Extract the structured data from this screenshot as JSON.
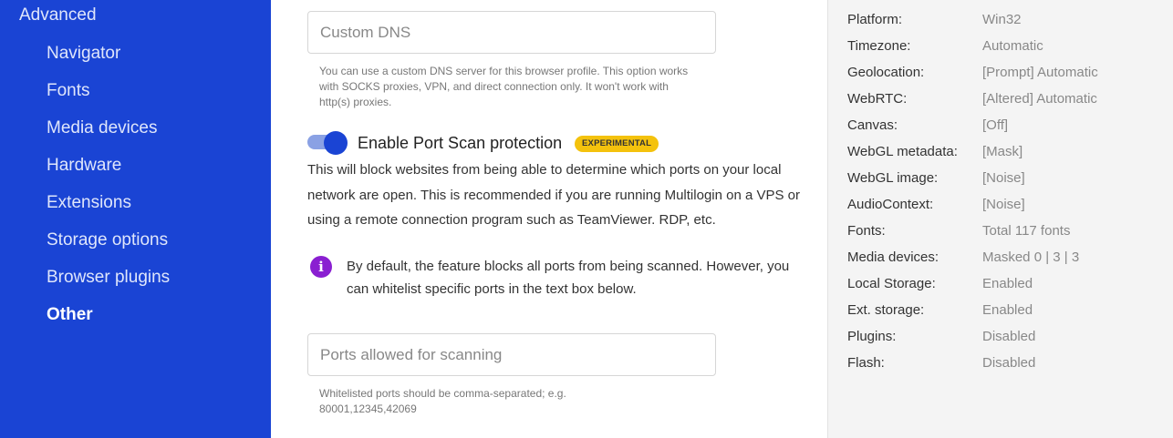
{
  "sidebar": {
    "section_title": "Advanced",
    "items": [
      {
        "label": "Navigator"
      },
      {
        "label": "Fonts"
      },
      {
        "label": "Media devices"
      },
      {
        "label": "Hardware"
      },
      {
        "label": "Extensions"
      },
      {
        "label": "Storage options"
      },
      {
        "label": "Browser plugins"
      },
      {
        "label": "Other",
        "active": true
      }
    ]
  },
  "main": {
    "custom_dns": {
      "placeholder": "Custom DNS",
      "value": "",
      "hint": "You can use a custom DNS server for this browser profile. This option works with SOCKS proxies, VPN, and direct connection only. It won't work with http(s) proxies."
    },
    "port_scan": {
      "toggle_on": true,
      "label": "Enable Port Scan protection",
      "badge": "EXPERIMENTAL",
      "description": "This will block websites from being able to determine which ports on your local network are open. This is recommended if you are running Multilogin on a VPS or using a remote connection program such as TeamViewer. RDP, etc.",
      "info_icon": "info-icon",
      "info": "By default, the feature blocks all ports from being scanned. However, you can whitelist specific ports in the text box below."
    },
    "ports_allowed": {
      "placeholder": "Ports allowed for scanning",
      "value": "",
      "hint": "Whitelisted ports should be comma-separated; e.g. 80001,12345,42069"
    }
  },
  "summary": {
    "rows": [
      {
        "key": "Platform:",
        "value": "Win32"
      },
      {
        "key": "Timezone:",
        "value": "Automatic"
      },
      {
        "key": "Geolocation:",
        "value": "[Prompt] Automatic"
      },
      {
        "key": "WebRTC:",
        "value": "[Altered] Automatic"
      },
      {
        "key": "Canvas:",
        "value": "[Off]"
      },
      {
        "key": "WebGL metadata:",
        "value": "[Mask]"
      },
      {
        "key": "WebGL image:",
        "value": "[Noise]"
      },
      {
        "key": "AudioContext:",
        "value": "[Noise]"
      },
      {
        "key": "Fonts:",
        "value": "Total 117 fonts"
      },
      {
        "key": "Media devices:",
        "value": "Masked 0 | 3 | 3"
      },
      {
        "key": "Local Storage:",
        "value": "Enabled"
      },
      {
        "key": "Ext. storage:",
        "value": "Enabled"
      },
      {
        "key": "Plugins:",
        "value": "Disabled"
      },
      {
        "key": "Flash:",
        "value": "Disabled"
      }
    ]
  },
  "colors": {
    "sidebar_bg": "#1a44d4",
    "badge_bg": "#f4c20d",
    "info_icon_bg": "#8a1fd1"
  }
}
